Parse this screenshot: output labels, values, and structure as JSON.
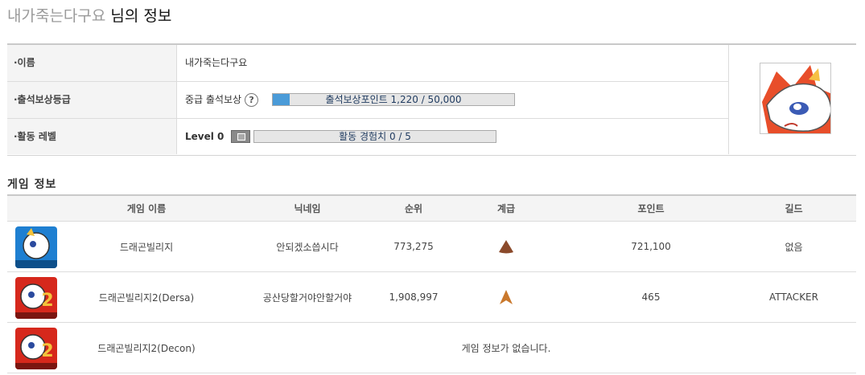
{
  "header": {
    "nickname": "내가죽는다구요",
    "suffix": "님의 정보"
  },
  "profile": {
    "name_label": "·이름",
    "name_value": "내가죽는다구요",
    "attendance_label": "·출석보상등급",
    "attendance_grade": "중급 출석보상",
    "help_icon": "?",
    "attendance_bar": {
      "text": "출석보상포인트 1,220 / 50,000",
      "current": 1220,
      "max": 50000
    },
    "activity_label": "·활동 레벨",
    "activity_level": "Level 0",
    "activity_bar": {
      "text": "활동 경험치 0 / 5",
      "current": 0,
      "max": 5
    }
  },
  "game_info": {
    "section_title": "게임 정보",
    "columns": [
      "게임 이름",
      "닉네임",
      "순위",
      "계급",
      "포인트",
      "길드"
    ],
    "rows": [
      {
        "icon": "dragon-village-icon",
        "name": "드래곤빌리지",
        "nickname": "안되겠소씁시다",
        "rank": "773,275",
        "grade_icon": "rank-triangle-icon",
        "point": "721,100",
        "guild": "없음"
      },
      {
        "icon": "dragon-village-2-icon",
        "name": "드래곤빌리지2(Dersa)",
        "nickname": "공산당할거야안할거야",
        "rank": "1,908,997",
        "grade_icon": "rank-arrow-icon",
        "point": "465",
        "guild": "ATTACKER"
      },
      {
        "icon": "dragon-village-2-icon",
        "name": "드래곤빌리지2(Decon)",
        "no_data": "게임 정보가 없습니다."
      }
    ]
  },
  "colors": {
    "bar_fill": "#4a9bd8",
    "header_bg": "#f4f4f4",
    "grade_brown": "#8b4a2b",
    "grade_orange": "#c9782c"
  }
}
